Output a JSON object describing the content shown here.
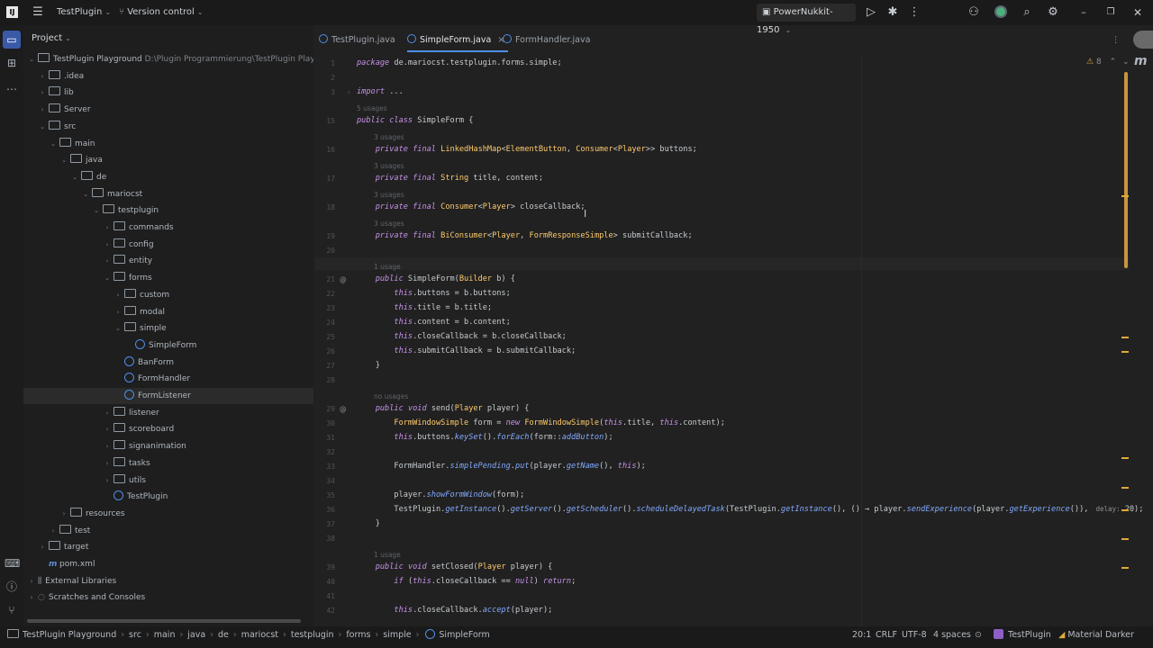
{
  "titlebar": {
    "project_name": "TestPlugin",
    "vcs": "Version control",
    "run_config": "PowerNukkit-1950"
  },
  "project_panel": {
    "title": "Project",
    "tree": [
      {
        "label": "TestPlugin Playground",
        "path": "D:\\Plugin Programmierung\\TestPlugin Playground",
        "type": "module",
        "depth": 0,
        "open": true
      },
      {
        "label": ".idea",
        "type": "folder",
        "depth": 1,
        "open": false
      },
      {
        "label": "lib",
        "type": "folder",
        "depth": 1,
        "open": false
      },
      {
        "label": "Server",
        "type": "folder",
        "depth": 1,
        "open": false
      },
      {
        "label": "src",
        "type": "folder",
        "depth": 1,
        "open": true
      },
      {
        "label": "main",
        "type": "folder",
        "depth": 2,
        "open": true
      },
      {
        "label": "java",
        "type": "folder",
        "depth": 3,
        "open": true
      },
      {
        "label": "de",
        "type": "folder",
        "depth": 4,
        "open": true
      },
      {
        "label": "mariocst",
        "type": "folder",
        "depth": 5,
        "open": true
      },
      {
        "label": "testplugin",
        "type": "folder",
        "depth": 6,
        "open": true
      },
      {
        "label": "commands",
        "type": "folder",
        "depth": 7,
        "open": false
      },
      {
        "label": "config",
        "type": "folder",
        "depth": 7,
        "open": false
      },
      {
        "label": "entity",
        "type": "folder",
        "depth": 7,
        "open": false
      },
      {
        "label": "forms",
        "type": "folder",
        "depth": 7,
        "open": true
      },
      {
        "label": "custom",
        "type": "folder",
        "depth": 8,
        "open": false
      },
      {
        "label": "modal",
        "type": "folder",
        "depth": 8,
        "open": false
      },
      {
        "label": "simple",
        "type": "folder",
        "depth": 8,
        "open": true
      },
      {
        "label": "SimpleForm",
        "type": "class",
        "depth": 9
      },
      {
        "label": "BanForm",
        "type": "class",
        "depth": 8
      },
      {
        "label": "FormHandler",
        "type": "class",
        "depth": 8
      },
      {
        "label": "FormListener",
        "type": "class",
        "depth": 8,
        "selected": true
      },
      {
        "label": "listener",
        "type": "folder",
        "depth": 7,
        "open": false
      },
      {
        "label": "scoreboard",
        "type": "folder",
        "depth": 7,
        "open": false
      },
      {
        "label": "signanimation",
        "type": "folder",
        "depth": 7,
        "open": false
      },
      {
        "label": "tasks",
        "type": "folder",
        "depth": 7,
        "open": false
      },
      {
        "label": "utils",
        "type": "folder",
        "depth": 7,
        "open": false
      },
      {
        "label": "TestPlugin",
        "type": "class",
        "depth": 7
      },
      {
        "label": "resources",
        "type": "folder",
        "depth": 3,
        "open": false
      },
      {
        "label": "test",
        "type": "folder",
        "depth": 2,
        "open": false
      },
      {
        "label": "target",
        "type": "folder",
        "depth": 1,
        "open": false
      },
      {
        "label": "pom.xml",
        "type": "maven",
        "depth": 1
      },
      {
        "label": "External Libraries",
        "type": "lib",
        "depth": 0,
        "open": false
      },
      {
        "label": "Scratches and Consoles",
        "type": "scratch",
        "depth": 0,
        "open": false
      }
    ]
  },
  "tabs": [
    {
      "label": "TestPlugin.java",
      "active": false
    },
    {
      "label": "SimpleForm.java",
      "active": true,
      "close": "×"
    },
    {
      "label": "FormHandler.java",
      "active": false
    }
  ],
  "editor": {
    "warning_count": "8",
    "lines": [
      {
        "n": "1",
        "code": "package de.mariocst.testplugin.forms.simple;"
      },
      {
        "n": "2",
        "code": ""
      },
      {
        "n": "3",
        "code": "import ..."
      },
      {
        "n": "",
        "hint": "5 usages"
      },
      {
        "n": "15",
        "code": "public class SimpleForm {"
      },
      {
        "n": "",
        "hint": "3 usages"
      },
      {
        "n": "16",
        "code": "    private final LinkedHashMap<ElementButton, Consumer<Player>> buttons;"
      },
      {
        "n": "",
        "hint": "3 usages"
      },
      {
        "n": "17",
        "code": "    private final String title, content;"
      },
      {
        "n": "",
        "hint": "3 usages"
      },
      {
        "n": "18",
        "code": "    private final Consumer<Player> closeCallback;"
      },
      {
        "n": "",
        "hint": "3 usages"
      },
      {
        "n": "19",
        "code": "    private final BiConsumer<Player, FormResponseSimple> submitCallback;"
      },
      {
        "n": "20",
        "code": ""
      },
      {
        "n": "",
        "hint": "1 usage"
      },
      {
        "n": "21",
        "code": "    public SimpleForm(Builder b) {"
      },
      {
        "n": "22",
        "code": "        this.buttons = b.buttons;"
      },
      {
        "n": "23",
        "code": "        this.title = b.title;"
      },
      {
        "n": "24",
        "code": "        this.content = b.content;"
      },
      {
        "n": "25",
        "code": "        this.closeCallback = b.closeCallback;"
      },
      {
        "n": "26",
        "code": "        this.submitCallback = b.submitCallback;"
      },
      {
        "n": "27",
        "code": "    }"
      },
      {
        "n": "28",
        "code": ""
      },
      {
        "n": "",
        "hint": "no usages"
      },
      {
        "n": "29",
        "code": "    public void send(Player player) {"
      },
      {
        "n": "30",
        "code": "        FormWindowSimple form = new FormWindowSimple(this.title, this.content);"
      },
      {
        "n": "31",
        "code": "        this.buttons.keySet().forEach(form::addButton);"
      },
      {
        "n": "32",
        "code": ""
      },
      {
        "n": "33",
        "code": "        FormHandler.simplePending.put(player.getName(), this);"
      },
      {
        "n": "34",
        "code": ""
      },
      {
        "n": "35",
        "code": "        player.showFormWindow(form);"
      },
      {
        "n": "36",
        "code": "        TestPlugin.getInstance().getServer().getScheduler().scheduleDelayedTask(TestPlugin.getInstance(), () → player.sendExperience(player.getExperience()),",
        "param": "delay:",
        "tail": " 20);"
      },
      {
        "n": "37",
        "code": "    }"
      },
      {
        "n": "38",
        "code": ""
      },
      {
        "n": "",
        "hint": "1 usage"
      },
      {
        "n": "39",
        "code": "    public void setClosed(Player player) {"
      },
      {
        "n": "40",
        "code": "        if (this.closeCallback == null) return;"
      },
      {
        "n": "41",
        "code": ""
      },
      {
        "n": "42",
        "code": "        this.closeCallback.accept(player);"
      }
    ]
  },
  "statusbar": {
    "breadcrumbs": [
      "TestPlugin Playground",
      "src",
      "main",
      "java",
      "de",
      "mariocst",
      "testplugin",
      "forms",
      "simple",
      "SimpleForm"
    ],
    "position": "20:1",
    "line_sep": "CRLF",
    "encoding": "UTF-8",
    "indent": "4 spaces",
    "plugin": "TestPlugin",
    "theme": "Material Darker"
  }
}
